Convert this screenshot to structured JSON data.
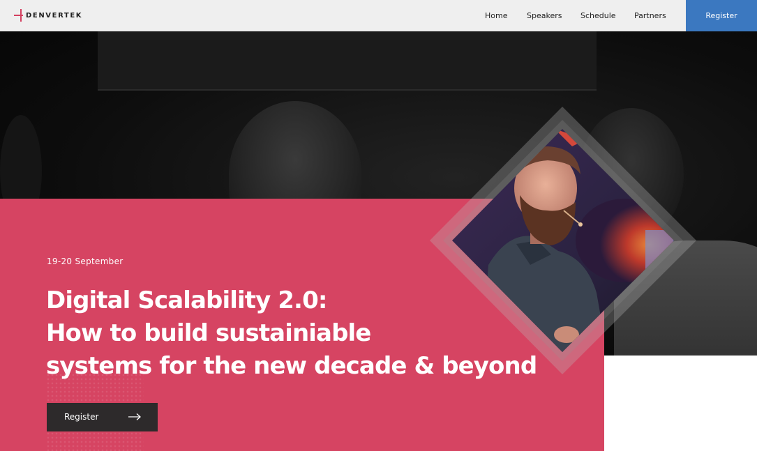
{
  "header": {
    "logo_text": "DENVERTEK",
    "nav": [
      "Home",
      "Speakers",
      "Schedule",
      "Partners"
    ],
    "register_label": "Register"
  },
  "hero": {
    "date": "19-20 September",
    "title_lines": [
      "Digital Scalability 2.0:",
      "How to build sustainiable",
      "systems for the new decade & beyond"
    ],
    "register_label": "Register"
  },
  "colors": {
    "accent_pink": "#d64462",
    "header_bg": "#efefef",
    "register_blue": "#3b78c0",
    "button_dark": "#2d2a2b"
  }
}
